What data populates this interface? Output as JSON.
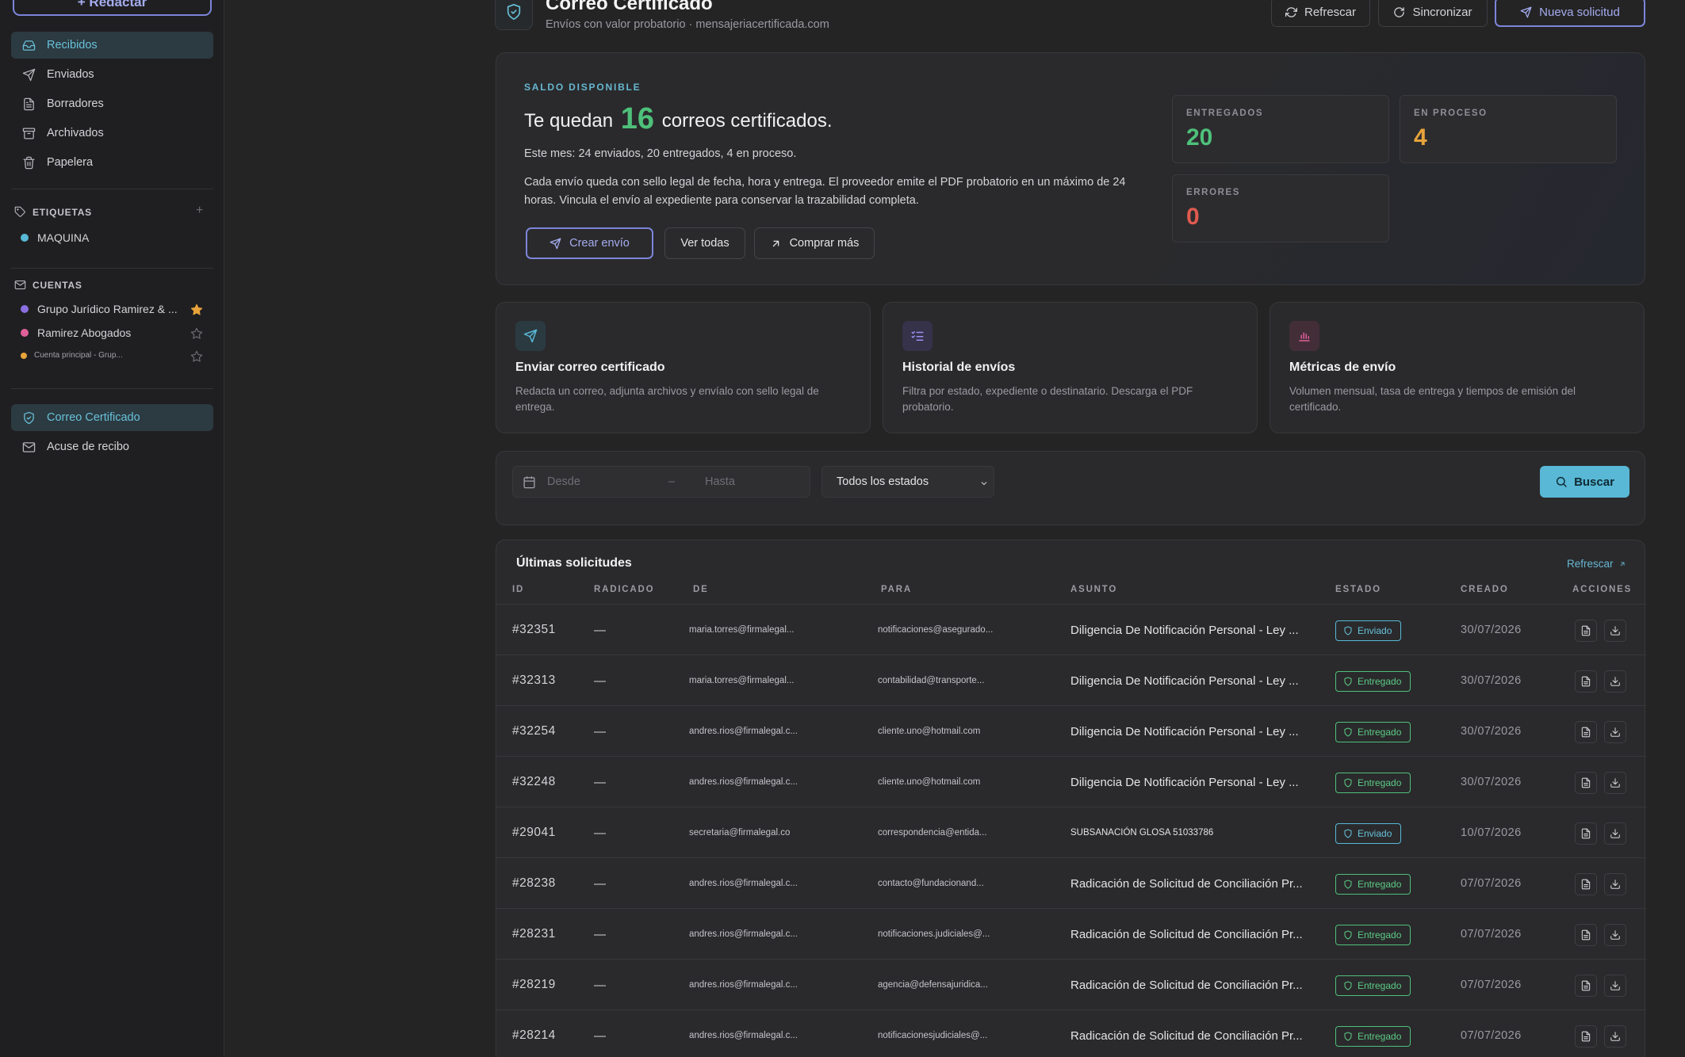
{
  "sidebar": {
    "compose_label": "+ Redactar",
    "mail_items": [
      {
        "label": "Recibidos",
        "icon": "inbox-icon",
        "active": true
      },
      {
        "label": "Enviados",
        "icon": "send-icon"
      },
      {
        "label": "Borradores",
        "icon": "document-icon"
      },
      {
        "label": "Archivados",
        "icon": "archive-icon"
      },
      {
        "label": "Papelera",
        "icon": "trash-icon"
      }
    ],
    "labels_heading": "ETIQUETAS",
    "labels": [
      {
        "name": "MAQUINA",
        "color": "#58b8d6"
      }
    ],
    "accounts_heading": "CUENTAS",
    "accounts": [
      {
        "name": "Grupo Jurídico Ramirez & ...",
        "color": "#8b6fe0",
        "starred": true
      },
      {
        "name": "Ramirez Abogados",
        "color": "#e0609a",
        "starred": false
      },
      {
        "name": "Cuenta principal - Grup...",
        "color": "#e8a33a",
        "starred": false
      }
    ],
    "tools": [
      {
        "label": "Correo Certificado",
        "icon": "shield-icon",
        "active": true
      },
      {
        "label": "Acuse de recibo",
        "icon": "mail-icon"
      }
    ]
  },
  "header": {
    "title": "Correo Certificado",
    "subtitle": "Envíos con valor probatorio · mensajeriacertificada.com",
    "refresh_label": "Refrescar",
    "sync_label": "Sincronizar",
    "new_request_label": "Nueva solicitud"
  },
  "hero": {
    "eyebrow": "SALDO DISPONIBLE",
    "headline_before": "Te quedan",
    "remaining": "16",
    "headline_after": "correos certificados.",
    "month_summary": "Este mes: 24 enviados, 20 entregados, 4 en proceso.",
    "description": "Cada envío queda con sello legal de fecha, hora y entrega. El proveedor emite el PDF probatorio en un máximo de 24 horas. Vincula el envío al expediente para conservar la trazabilidad completa.",
    "create_label": "Crear envío",
    "view_all_label": "Ver todas",
    "buy_more_label": "Comprar más",
    "stats": [
      {
        "label": "ENTREGADOS",
        "value": "20",
        "color": "#4ec07a"
      },
      {
        "label": "EN PROCESO",
        "value": "4",
        "color": "#e8a33a"
      },
      {
        "label": "ERRORES",
        "value": "0",
        "color": "#e05a4f"
      }
    ]
  },
  "features": [
    {
      "title": "Enviar correo certificado",
      "desc": "Redacta un correo, adjunta archivos y envíalo con sello legal de entrega.",
      "icon": "send-icon",
      "accent": "#58b8d6"
    },
    {
      "title": "Historial de envíos",
      "desc": "Filtra por estado, expediente o destinatario. Descarga el PDF probatorio.",
      "icon": "list-check-icon",
      "accent": "#9b8ff0"
    },
    {
      "title": "Métricas de envío",
      "desc": "Volumen mensual, tasa de entrega y tiempos de emisión del certificado.",
      "icon": "bar-chart-icon",
      "accent": "#e0609a"
    }
  ],
  "filters": {
    "from_placeholder": "Desde",
    "separator": "–",
    "to_placeholder": "Hasta",
    "status_selected": "Todos los estados",
    "search_label": "Buscar"
  },
  "table": {
    "title": "Últimas solicitudes",
    "refresh_link": "Refrescar",
    "columns": [
      "ID",
      "RADICADO",
      "DE",
      "PARA",
      "ASUNTO",
      "ESTADO",
      "CREADO",
      "ACCIONES"
    ],
    "rows": [
      {
        "id": "#32351",
        "radicado": "—",
        "de": "maria.torres@firmalegal...",
        "para": "notificaciones@asegurado...",
        "asunto": "Diligencia De Notificación Personal - Ley ...",
        "estado": "Enviado",
        "creado": "30/07/2026"
      },
      {
        "id": "#32313",
        "radicado": "—",
        "de": "maria.torres@firmalegal...",
        "para": "contabilidad@transporte...",
        "asunto": "Diligencia De Notificación Personal - Ley ...",
        "estado": "Entregado",
        "creado": "30/07/2026"
      },
      {
        "id": "#32254",
        "radicado": "—",
        "de": "andres.rios@firmalegal.c...",
        "para": "cliente.uno@hotmail.com",
        "asunto": "Diligencia De Notificación Personal - Ley ...",
        "estado": "Entregado",
        "creado": "30/07/2026"
      },
      {
        "id": "#32248",
        "radicado": "—",
        "de": "andres.rios@firmalegal.c...",
        "para": "cliente.uno@hotmail.com",
        "asunto": "Diligencia De Notificación Personal - Ley ...",
        "estado": "Entregado",
        "creado": "30/07/2026"
      },
      {
        "id": "#29041",
        "radicado": "—",
        "de": "secretaria@firmalegal.co",
        "para": "correspondencia@entida...",
        "asunto": "SUBSANACIÓN GLOSA 51033786",
        "estado": "Enviado",
        "creado": "10/07/2026"
      },
      {
        "id": "#28238",
        "radicado": "—",
        "de": "andres.rios@firmalegal.c...",
        "para": "contacto@fundacionand...",
        "asunto": "Radicación de Solicitud de Conciliación Pr...",
        "estado": "Entregado",
        "creado": "07/07/2026"
      },
      {
        "id": "#28231",
        "radicado": "—",
        "de": "andres.rios@firmalegal.c...",
        "para": "notificaciones.judiciales@...",
        "asunto": "Radicación de Solicitud de Conciliación Pr...",
        "estado": "Entregado",
        "creado": "07/07/2026"
      },
      {
        "id": "#28219",
        "radicado": "—",
        "de": "andres.rios@firmalegal.c...",
        "para": "agencia@defensajuridica...",
        "asunto": "Radicación de Solicitud de Conciliación Pr...",
        "estado": "Entregado",
        "creado": "07/07/2026"
      },
      {
        "id": "#28214",
        "radicado": "—",
        "de": "andres.rios@firmalegal.c...",
        "para": "notificacionesjudiciales@...",
        "asunto": "Radicación de Solicitud de Conciliación Pr...",
        "estado": "Entregado",
        "creado": "07/07/2026"
      }
    ]
  }
}
